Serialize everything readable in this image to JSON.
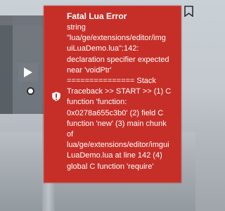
{
  "error_dialog": {
    "title": "Fatal Lua Error",
    "message_lines": [
      "string",
      "\"lua/ge/extensions/editor/img",
      "uiLuaDemo.lua\":142:",
      "declaration specifier expected",
      "near 'voidPtr'",
      "=============== Stack",
      "Traceback >> START >> (1) C",
      "function 'function:",
      "0x0278a655c3b0' (2) field C",
      "function 'new' (3) main chunk",
      "of",
      "lua/ge/extensions/editor/imgui",
      "LuaDemo.lua at line 142 (4)",
      "global C function 'require'"
    ],
    "icon": "exclamation-shield-icon",
    "background_color": "#c62f28",
    "text_color": "#ffffff"
  },
  "background_ui": {
    "play_icon": "play-icon",
    "radio_icon": "radio-button-icon",
    "corner_icon": "bookmark-icon"
  }
}
